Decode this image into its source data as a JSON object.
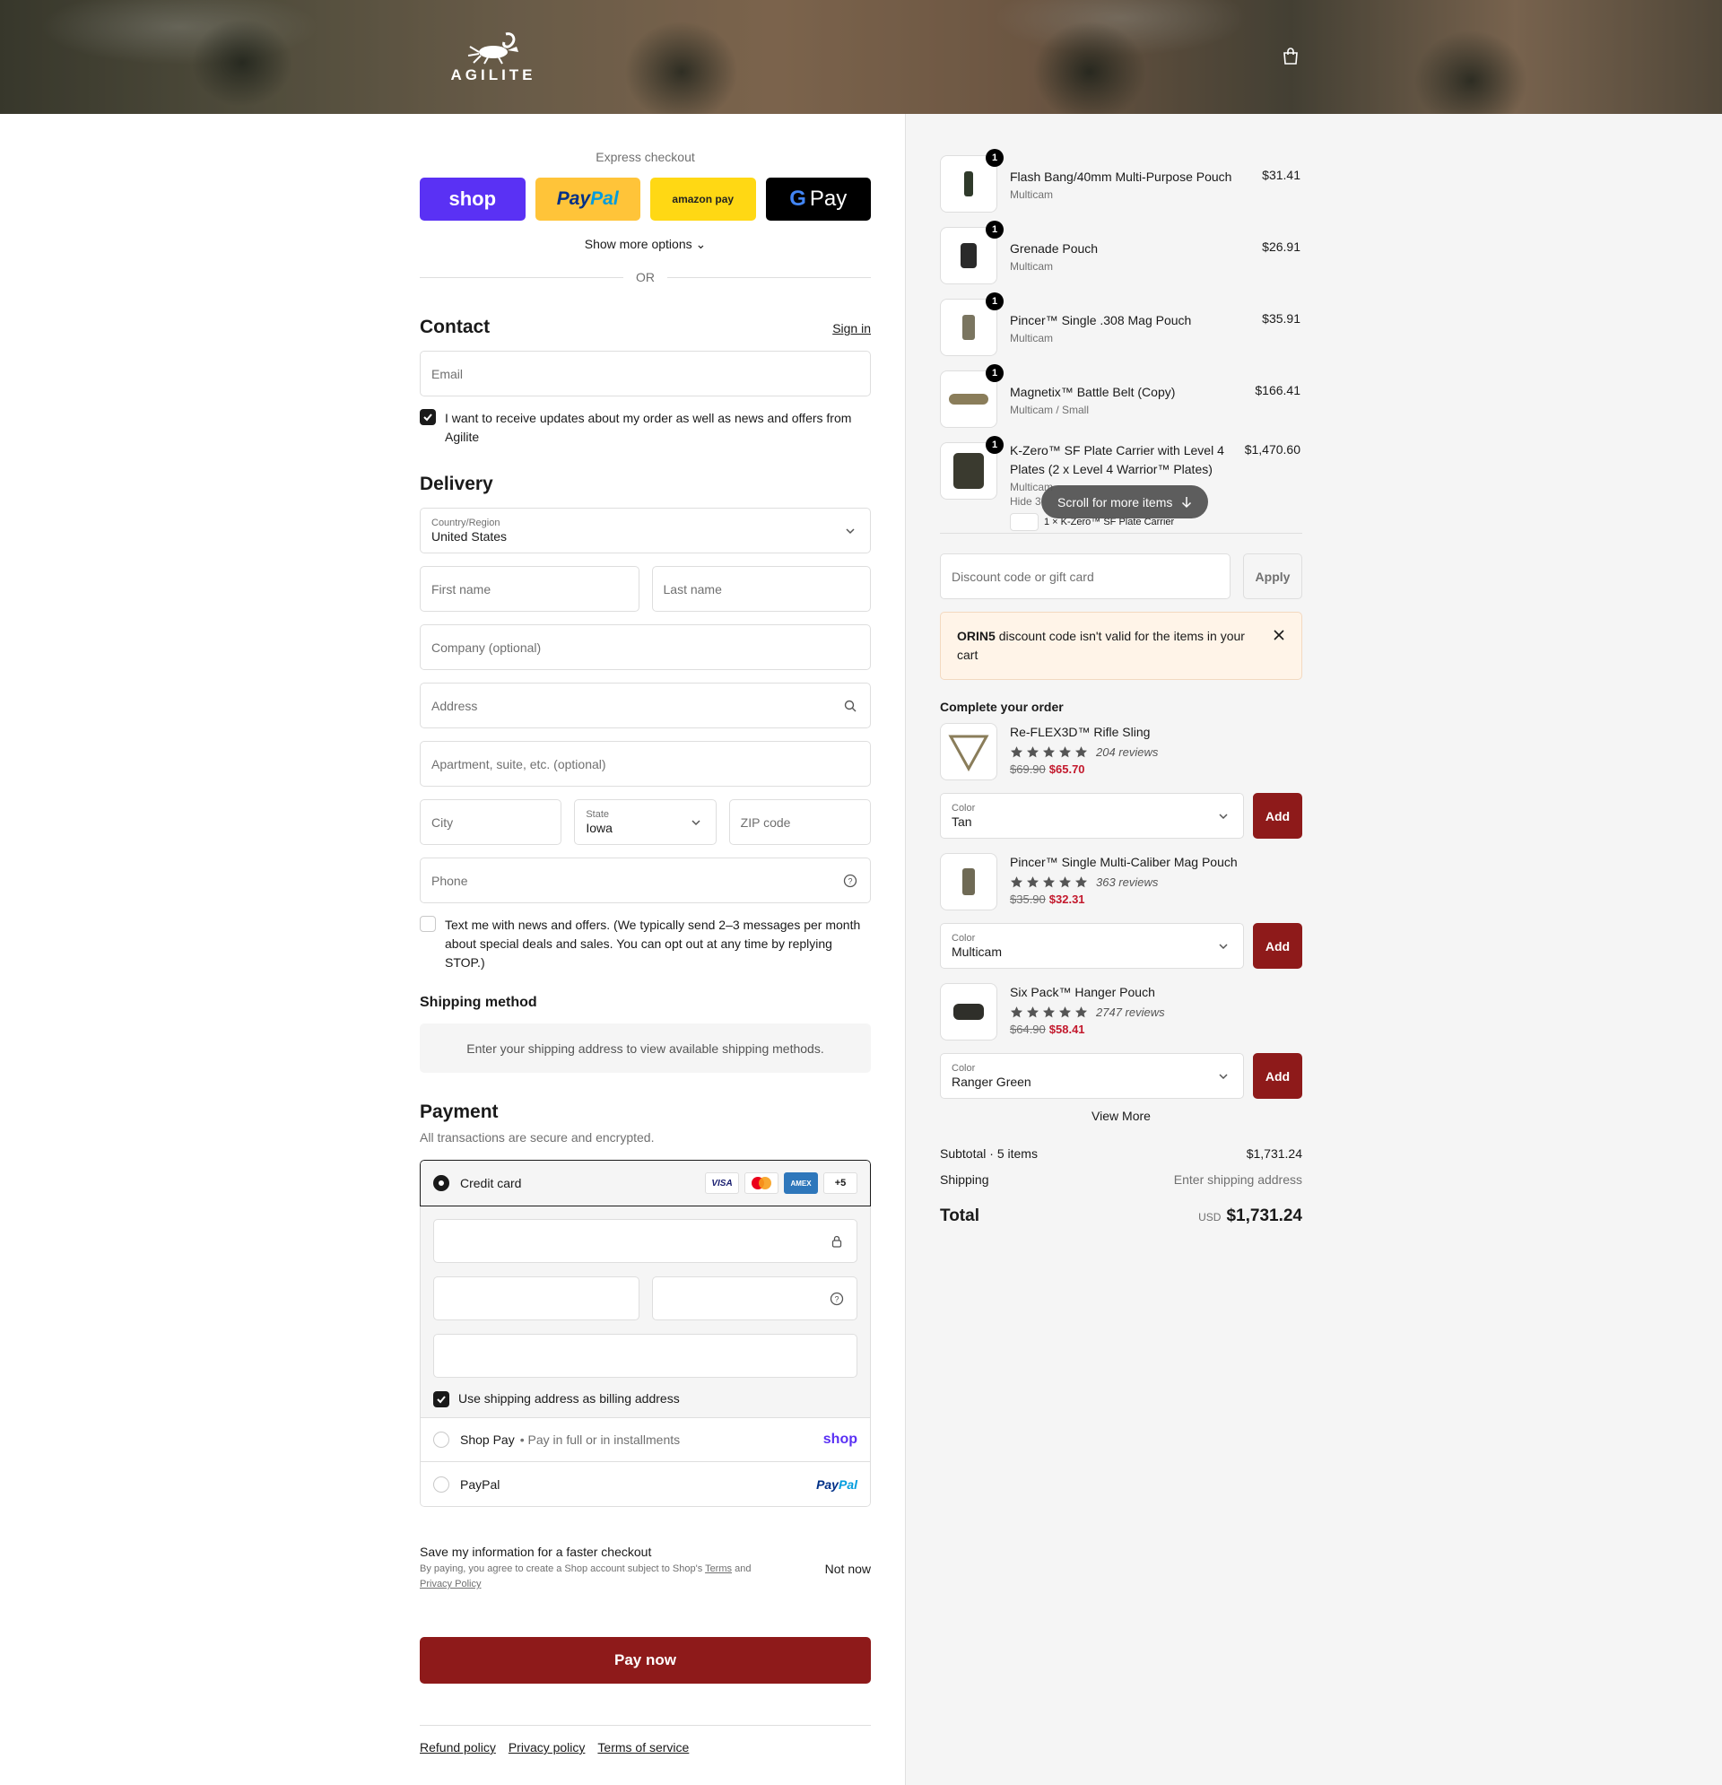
{
  "header": {
    "logo_text": "AGILITE"
  },
  "express": {
    "title": "Express checkout",
    "shop": "shop",
    "paypal_a": "Pay",
    "paypal_b": "Pal",
    "amazon": "amazon pay",
    "gpay_g": "G",
    "gpay": "Pay",
    "more": "Show more options",
    "or": "OR"
  },
  "contact": {
    "title": "Contact",
    "sign_in": "Sign in",
    "email_placeholder": "Email",
    "updates_label": "I want to receive updates about my order as well as news and offers from Agilite"
  },
  "delivery": {
    "title": "Delivery",
    "country_label": "Country/Region",
    "country_value": "United States",
    "first_name": "First name",
    "last_name": "Last name",
    "company": "Company (optional)",
    "address": "Address",
    "apartment": "Apartment, suite, etc. (optional)",
    "city": "City",
    "state_label": "State",
    "state_value": "Iowa",
    "zip": "ZIP code",
    "phone": "Phone",
    "sms_label": "Text me with news and offers. (We typically send 2–3 messages per month about special deals and sales. You can opt out at any time by replying STOP.)"
  },
  "shipping": {
    "title": "Shipping method",
    "message": "Enter your shipping address to view available shipping methods."
  },
  "payment": {
    "title": "Payment",
    "subtitle": "All transactions are secure and encrypted.",
    "credit_card": "Credit card",
    "cards": [
      "VISA",
      "AMEX",
      "+5"
    ],
    "billing_label": "Use shipping address as billing address",
    "shop_pay": "Shop Pay",
    "shop_pay_note": "Pay in full or in installments",
    "shop_logo": "shop",
    "paypal": "PayPal",
    "paypal_logo_a": "Pay",
    "paypal_logo_b": "Pal"
  },
  "save_info": {
    "title": "Save my information for a faster checkout",
    "legal_a": "By paying, you agree to create a Shop account subject to Shop's",
    "terms": "Terms",
    "and": "and",
    "privacy": "Privacy Policy",
    "not_now": "Not now"
  },
  "pay_now": "Pay now",
  "footer": {
    "refund": "Refund policy",
    "privacy": "Privacy policy",
    "terms": "Terms of service"
  },
  "cart": {
    "items": [
      {
        "name": "Flash Bang/40mm Multi-Purpose Pouch",
        "variant": "Multicam",
        "price": "$31.41",
        "qty": "1"
      },
      {
        "name": "Grenade Pouch",
        "variant": "Multicam",
        "price": "$26.91",
        "qty": "1"
      },
      {
        "name": "Pincer™ Single .308 Mag Pouch",
        "variant": "Multicam",
        "price": "$35.91",
        "qty": "1"
      },
      {
        "name": "Magnetix™ Battle Belt (Copy)",
        "variant": "Multicam / Small",
        "price": "$166.41",
        "qty": "1"
      },
      {
        "name": "K-Zero™ SF Plate Carrier with Level 4 Plates (2 x Level 4 Warrior™ Plates)",
        "variant": "Multicam",
        "price": "$1,470.60",
        "qty": "1",
        "hide": "Hide 3",
        "sub": "1 × K-Zero™ SF Plate Carrier"
      }
    ],
    "scroll_hint": "Scroll for more items"
  },
  "discount": {
    "placeholder": "Discount code or gift card",
    "apply": "Apply",
    "code": "ORIN5",
    "error": "discount code isn't valid for the items in your cart"
  },
  "upsell": {
    "title": "Complete your order",
    "color_label": "Color",
    "add": "Add",
    "view_more": "View More",
    "items": [
      {
        "name": "Re-FLEX3D™ Rifle Sling",
        "reviews": "204 reviews",
        "old": "$69.90",
        "new": "$65.70",
        "color": "Tan",
        "rating": 5
      },
      {
        "name": "Pincer™ Single Multi-Caliber Mag Pouch",
        "reviews": "363 reviews",
        "old": "$35.90",
        "new": "$32.31",
        "color": "Multicam",
        "rating": 5
      },
      {
        "name": "Six Pack™ Hanger Pouch",
        "reviews": "2747 reviews",
        "old": "$64.90",
        "new": "$58.41",
        "color": "Ranger Green",
        "rating": 5
      }
    ]
  },
  "summary": {
    "subtotal_label": "Subtotal · 5 items",
    "subtotal": "$1,731.24",
    "shipping_label": "Shipping",
    "shipping": "Enter shipping address",
    "total_label": "Total",
    "currency": "USD",
    "total": "$1,731.24"
  },
  "colors": {
    "accent": "#8e1a1a",
    "shop": "#5a31f4",
    "sale": "#c3192d"
  }
}
